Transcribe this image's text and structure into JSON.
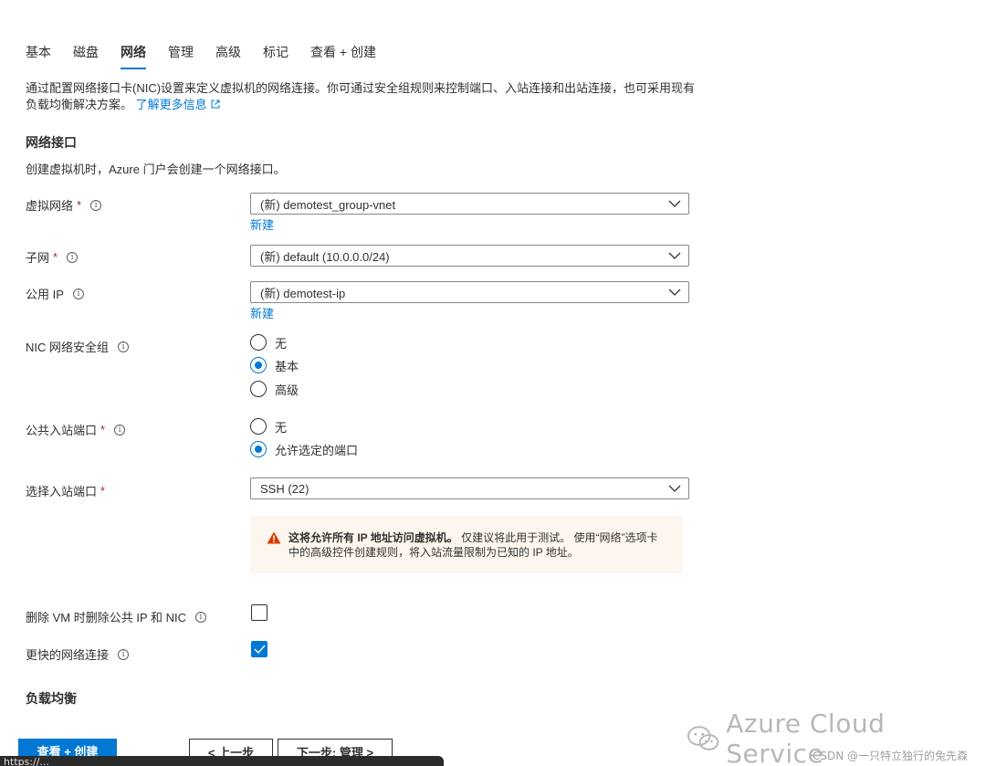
{
  "tabs": [
    "基本",
    "磁盘",
    "网络",
    "管理",
    "高级",
    "标记",
    "查看 + 创建"
  ],
  "active_tab_index": 2,
  "description": {
    "text": "通过配置网络接口卡(NIC)设置来定义虚拟机的网络连接。你可通过安全组规则来控制端口、入站连接和出站连接，也可采用现有负载均衡解决方案。",
    "link": "了解更多信息"
  },
  "nic_section": {
    "title": "网络接口",
    "desc": "创建虚拟机时，Azure 门户会创建一个网络接口。"
  },
  "fields": {
    "vnet": {
      "label": "虚拟网络",
      "required": "*",
      "value": "(新) demotest_group-vnet",
      "new_link": "新建"
    },
    "subnet": {
      "label": "子网",
      "required": "*",
      "value": "(新) default (10.0.0.0/24)"
    },
    "public_ip": {
      "label": "公用 IP",
      "value": "(新) demotest-ip",
      "new_link": "新建"
    },
    "nsg": {
      "label": "NIC 网络安全组",
      "options": [
        "无",
        "基本",
        "高级"
      ],
      "selected": 1
    },
    "inbound_ports": {
      "label": "公共入站端口",
      "required": "*",
      "options": [
        "无",
        "允许选定的端口"
      ],
      "selected": 1
    },
    "select_ports": {
      "label": "选择入站端口",
      "required": "*",
      "value": "SSH (22)"
    },
    "delete_ip_nic": {
      "label": "删除 VM 时删除公共 IP 和 NIC",
      "checked": false
    },
    "accelerated": {
      "label": "更快的网络连接",
      "checked": true
    }
  },
  "warning": {
    "bold": "这将允许所有 IP 地址访问虚拟机。",
    "line1": " 仅建议将此用于测试。 使用“网络”选项卡",
    "line2": "中的高级控件创建规则，将入站流量限制为已知的 IP 地址。"
  },
  "lb_section": {
    "title": "负载均衡"
  },
  "buttons": {
    "review": "查看 + 创建",
    "prev": "< 上一步",
    "next": "下一步: 管理 >"
  },
  "status_bar": "https://...",
  "watermark": {
    "text": "Azure Cloud Service",
    "csdn": "CSDN @一只特立独行的兔先森"
  },
  "colors": {
    "accent": "#0078d4",
    "required": "#a4262c",
    "warning": "#d83b01"
  },
  "icons": [
    "info-icon",
    "chevron-down-icon",
    "external-link-icon",
    "warning-icon",
    "checkmark-icon",
    "wechat-icon"
  ]
}
